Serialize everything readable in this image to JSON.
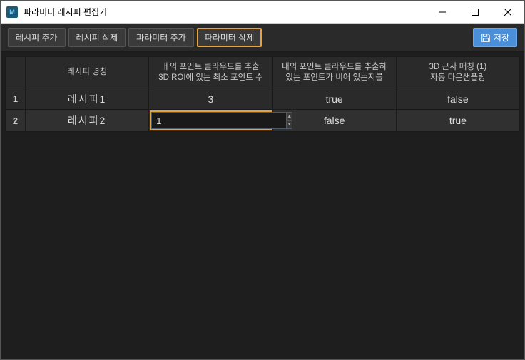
{
  "window": {
    "title": "파라미터 레시피 편집기"
  },
  "toolbar": {
    "add_recipe": "레시피 추가",
    "delete_recipe": "레시피 삭제",
    "add_param": "파라미터 추가",
    "delete_param": "파라미터 삭제",
    "save": "저장"
  },
  "table": {
    "headers": {
      "idx": "",
      "name": "레시피 명칭",
      "col1": "ㅐ의 포인트 클라우드를 추출\n3D ROI에 있는 최소 포인트 수",
      "col2": "내의 포인트 클라우드를 추출하\n있는 포인트가 비어 있는지를",
      "col3": "3D 근사 매칭 (1)\n자동 다운샘플링"
    },
    "rows": [
      {
        "idx": "1",
        "name": "레시피1",
        "c1": "3",
        "c2": "true",
        "c3": "false"
      },
      {
        "idx": "2",
        "name": "레시피2",
        "c1": "1",
        "c2": "false",
        "c3": "true"
      }
    ]
  }
}
